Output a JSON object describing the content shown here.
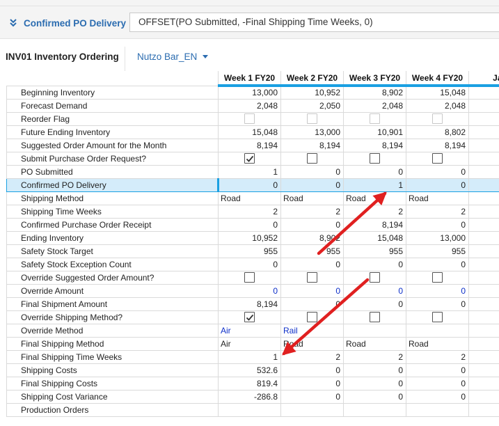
{
  "formula_bar": {
    "line_item": "Confirmed PO Delivery",
    "formula": "OFFSET(PO Submitted, -Final Shipping Time Weeks, 0)",
    "expand_icon": "double-chevron-down-icon"
  },
  "tabs": {
    "module_name": "INV01 Inventory Ordering",
    "dropdown_value": "Nutzo Bar_EN",
    "dropdown_icon": "caret-down-icon"
  },
  "grid": {
    "columns": [
      "Week 1 FY20",
      "Week 2 FY20",
      "Week 3 FY20",
      "Week 4 FY20",
      "Jan"
    ],
    "rows": [
      {
        "label": "Beginning Inventory",
        "type": "num",
        "values": [
          "13,000",
          "10,952",
          "8,902",
          "15,048"
        ]
      },
      {
        "label": "Forecast Demand",
        "type": "num",
        "values": [
          "2,048",
          "2,050",
          "2,048",
          "2,048"
        ]
      },
      {
        "label": "Reorder Flag",
        "type": "check",
        "dim": true,
        "values": [
          false,
          false,
          false,
          false
        ]
      },
      {
        "label": "Future Ending Inventory",
        "type": "num",
        "values": [
          "15,048",
          "13,000",
          "10,901",
          "8,802"
        ]
      },
      {
        "label": "Suggested Order Amount for the Month",
        "type": "num",
        "values": [
          "8,194",
          "8,194",
          "8,194",
          "8,194"
        ]
      },
      {
        "label": "Submit Purchase Order Request?",
        "type": "check",
        "values": [
          true,
          false,
          false,
          false
        ]
      },
      {
        "label": "PO Submitted",
        "type": "num",
        "values": [
          "1",
          "0",
          "0",
          "0"
        ]
      },
      {
        "label": "Confirmed PO Delivery",
        "type": "num",
        "selected": true,
        "values": [
          "0",
          "0",
          "1",
          "0"
        ]
      },
      {
        "label": "Shipping Method",
        "type": "text",
        "values": [
          "Road",
          "Road",
          "Road",
          "Road"
        ]
      },
      {
        "label": "Shipping Time Weeks",
        "type": "num",
        "values": [
          "2",
          "2",
          "2",
          "2"
        ]
      },
      {
        "label": "Confirmed Purchase Order Receipt",
        "type": "num",
        "values": [
          "0",
          "0",
          "8,194",
          "0"
        ]
      },
      {
        "label": "Ending Inventory",
        "type": "num",
        "values": [
          "10,952",
          "8,902",
          "15,048",
          "13,000"
        ]
      },
      {
        "label": "Safety Stock Target",
        "type": "num",
        "values": [
          "955",
          "955",
          "955",
          "955"
        ]
      },
      {
        "label": "Safety Stock Exception Count",
        "type": "num",
        "values": [
          "0",
          "0",
          "0",
          "0"
        ]
      },
      {
        "label": "Override Suggested Order Amount?",
        "type": "check",
        "values": [
          false,
          false,
          false,
          false
        ]
      },
      {
        "label": "Override Amount",
        "type": "num",
        "blue": true,
        "values": [
          "0",
          "0",
          "0",
          "0"
        ]
      },
      {
        "label": "Final Shipment Amount",
        "type": "num",
        "values": [
          "8,194",
          "0",
          "0",
          "0"
        ]
      },
      {
        "label": "Override Shipping Method?",
        "type": "check",
        "values": [
          true,
          false,
          false,
          false
        ]
      },
      {
        "label": "Override Method",
        "type": "text",
        "blue": true,
        "values": [
          "Air",
          "Rail",
          "",
          ""
        ]
      },
      {
        "label": "Final Shipping Method",
        "type": "text",
        "values": [
          "Air",
          "Road",
          "Road",
          "Road"
        ]
      },
      {
        "label": "Final Shipping Time Weeks",
        "type": "num",
        "values": [
          "1",
          "2",
          "2",
          "2"
        ]
      },
      {
        "label": "Shipping Costs",
        "type": "num",
        "values": [
          "532.6",
          "0",
          "0",
          "0"
        ]
      },
      {
        "label": "Final Shipping Costs",
        "type": "num",
        "values": [
          "819.4",
          "0",
          "0",
          "0"
        ]
      },
      {
        "label": "Shipping Cost Variance",
        "type": "num",
        "values": [
          "-286.8",
          "0",
          "0",
          "0"
        ]
      },
      {
        "label": "Production Orders",
        "type": "num",
        "values": [
          "",
          "",
          "",
          ""
        ]
      }
    ]
  },
  "annotations": {
    "arrow_color": "#e02020",
    "arrows": [
      "arrow-to-confirmed-po-delivery-week3",
      "arrow-to-final-shipping-time-week1"
    ]
  }
}
